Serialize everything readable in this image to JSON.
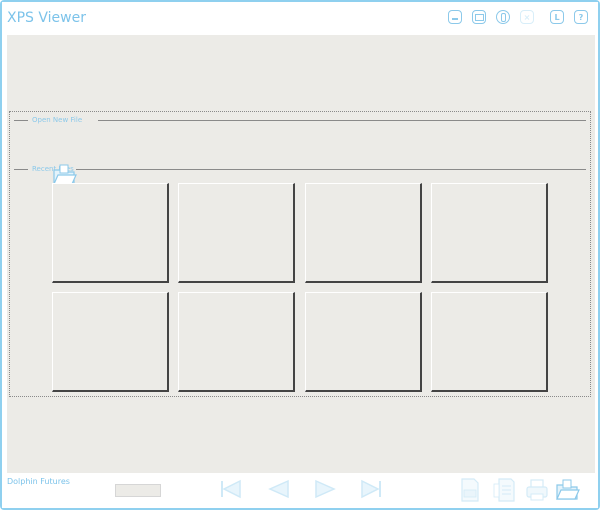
{
  "app": {
    "title": "XPS Viewer",
    "accent_color": "#8cc9ea",
    "background": "#ecebe7"
  },
  "titlebar_buttons": [
    {
      "name": "minimize-button",
      "icon": "minimize-icon",
      "glyph": ""
    },
    {
      "name": "maximize-button",
      "icon": "maximize-icon",
      "glyph": ""
    },
    {
      "name": "info-button",
      "icon": "info-icon",
      "glyph": ""
    },
    {
      "name": "close-button",
      "icon": "close-icon",
      "glyph": "×",
      "enabled": false
    },
    {
      "name": "license-button",
      "icon": "license-icon",
      "glyph": "L"
    },
    {
      "name": "help-button",
      "icon": "help-icon",
      "glyph": "?"
    }
  ],
  "open_section": {
    "label": "Open New File",
    "icon": "open-folder-icon"
  },
  "recent_section": {
    "label": "Recent Files",
    "slots": 8
  },
  "footer": {
    "brand": "Dolphin Futures",
    "page_field": "",
    "nav": [
      "first-page-icon",
      "previous-page-icon",
      "next-page-icon",
      "last-page-icon"
    ],
    "tools": [
      "pdf-export-icon",
      "text-export-icon",
      "print-icon",
      "open-folder-icon"
    ]
  }
}
